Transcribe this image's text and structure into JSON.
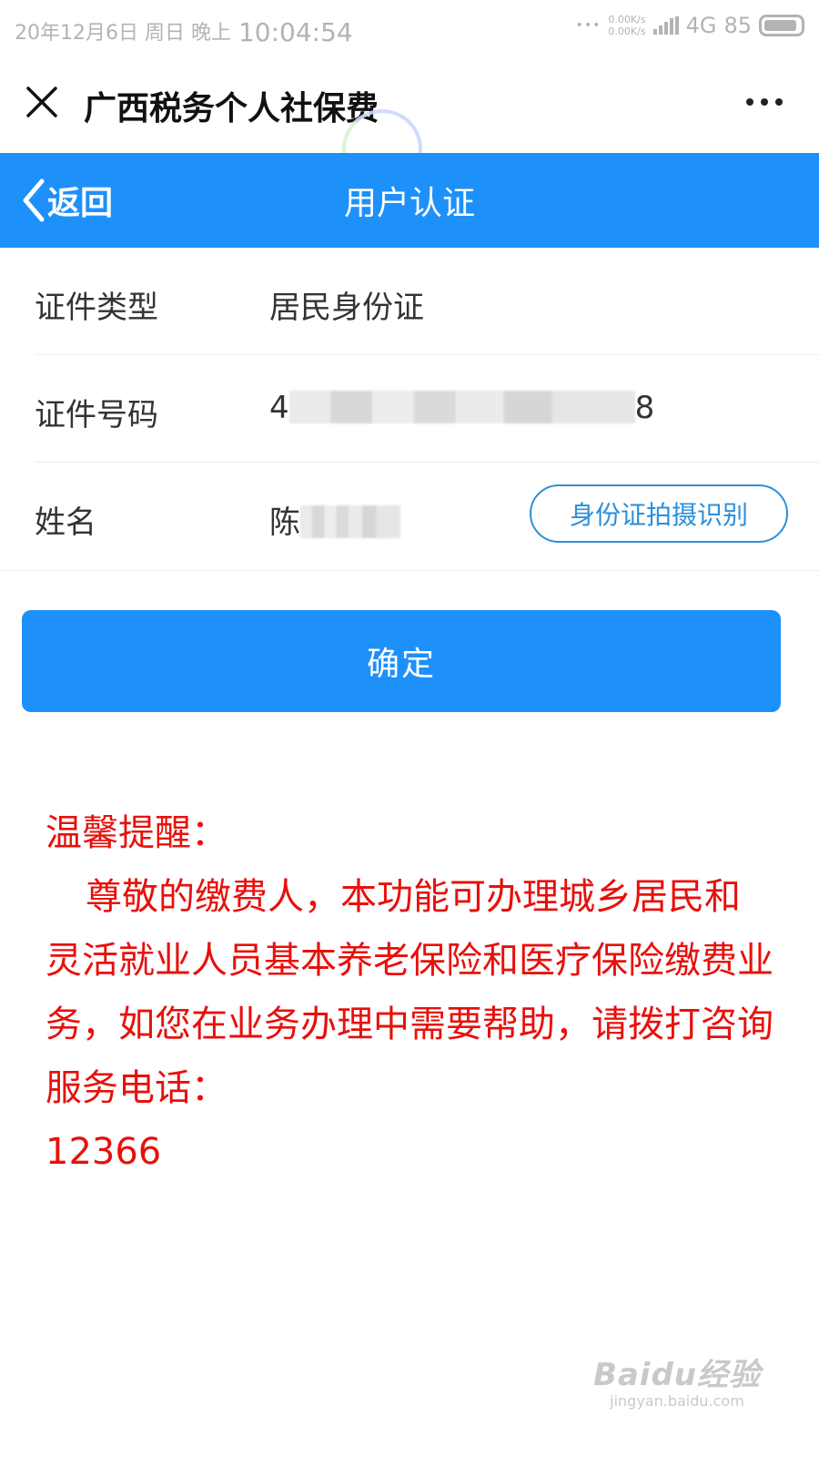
{
  "status_bar": {
    "datetime": "20年12月6日  周日  晚上",
    "clock": "10:04:54",
    "net_speed_up": "0.00K/s",
    "net_speed_down": "0.00K/s",
    "network": "4G",
    "battery": "85",
    "icons": [
      "signal-icon",
      "battery-icon"
    ]
  },
  "app_header": {
    "title": "广西税务个人社保费",
    "icons": [
      "close-icon",
      "more-icon",
      "loading-ring"
    ]
  },
  "nav_bar": {
    "back_label": "返回",
    "title": "用户认证",
    "icons": [
      "chevron-left-icon"
    ]
  },
  "form": {
    "id_type": {
      "label": "证件类型",
      "value": "居民身份证"
    },
    "id_number": {
      "label": "证件号码",
      "prefix": "4",
      "suffix": "8"
    },
    "name": {
      "label": "姓名",
      "prefix": "陈"
    },
    "scan_button": "身份证拍摄识别"
  },
  "confirm_button": "确定",
  "notice": {
    "title": "温馨提醒：",
    "body": "尊敬的缴费人，本功能可办理城乡居民和灵活就业人员基本养老保险和医疗保险缴费业务，如您在业务办理中需要帮助，请拨打咨询服务电话：",
    "phone": "12366"
  },
  "watermark": {
    "brand": "Baidu经验",
    "url": "jingyan.baidu.com"
  },
  "colors": {
    "primary": "#1e90fa",
    "notice_red": "#e8100c",
    "scan_border": "#2b8fd8"
  }
}
